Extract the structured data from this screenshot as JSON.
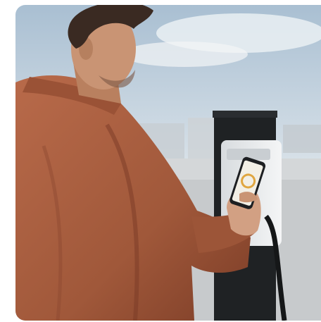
{
  "image": {
    "subject": "man-using-phone-at-ev-charger",
    "palette": {
      "sky_top": "#9fb6cc",
      "sky_bottom": "#dfe6ec",
      "ground": "#c9ccce",
      "shirt": "#a35a3c",
      "shirt_shadow": "#6f3522",
      "skin": "#c99474",
      "hair": "#3a2a22",
      "charger_post": "#1f2224",
      "charger_unit": "#e9ecee",
      "phone_screen": "#f2efe6"
    }
  }
}
